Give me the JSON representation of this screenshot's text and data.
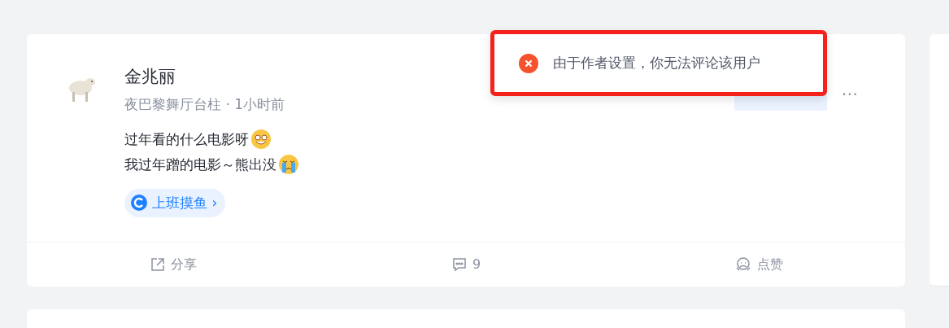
{
  "post": {
    "author": "金兆丽",
    "subtitle": "夜巴黎舞厅台柱",
    "separator": "·",
    "time": "1小时前",
    "more": "⋯",
    "lines": [
      {
        "text": "过年看的什么电影呀",
        "kind": "grin"
      },
      {
        "text": "我过年蹭的电影～熊出没",
        "kind": "cry"
      }
    ],
    "topic": {
      "label": "上班摸鱼",
      "arrow": "›"
    },
    "actions": [
      {
        "kind": "share",
        "label": "分享"
      },
      {
        "kind": "comment",
        "label": "9"
      },
      {
        "kind": "like",
        "label": "点赞"
      }
    ]
  },
  "toast": {
    "kind": "error",
    "message": "由于作者设置，你无法评论该用户",
    "highlighted": true
  }
}
